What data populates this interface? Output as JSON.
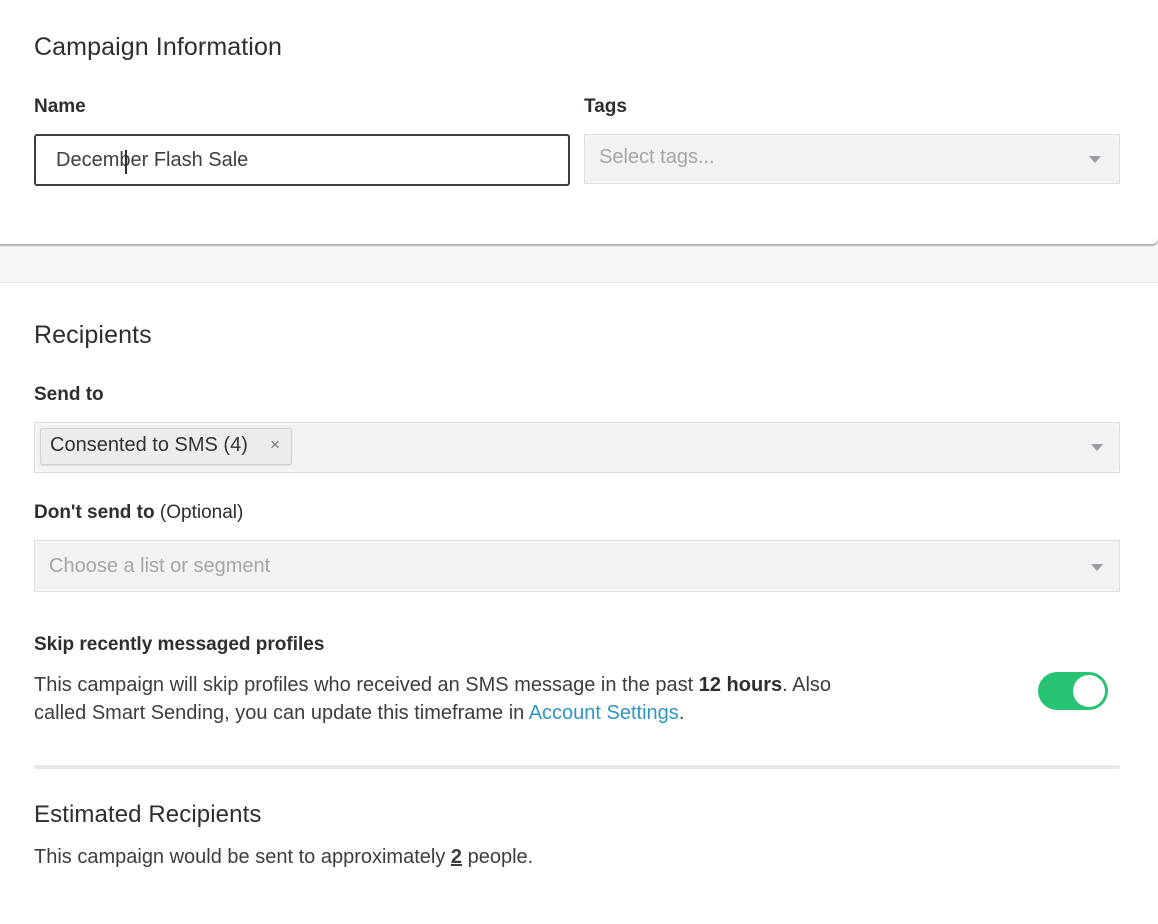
{
  "campaign_info": {
    "title": "Campaign Information",
    "name_label": "Name",
    "name_value": "December Flash Sale",
    "tags_label": "Tags",
    "tags_placeholder": "Select tags..."
  },
  "recipients": {
    "title": "Recipients",
    "send_to_label": "Send to",
    "send_to_chips": [
      {
        "label": "Consented to SMS (4)",
        "remove_glyph": "×"
      }
    ],
    "dont_send_label": "Don't send to",
    "dont_send_optional": "(Optional)",
    "dont_send_placeholder": "Choose a list or segment",
    "skip_title": "Skip recently messaged profiles",
    "skip_text_1": "This campaign will skip profiles who received an SMS message in the past ",
    "skip_text_bold": "12 hours",
    "skip_text_2": ". Also",
    "skip_text_3": "called Smart Sending, you can update this timeframe in ",
    "skip_link": "Account Settings",
    "skip_text_4": ".",
    "skip_toggle_on": true,
    "toggle_color": "#27c272",
    "link_color": "#2f95c4"
  },
  "estimated": {
    "title": "Estimated Recipients",
    "text_1": "This campaign would be sent to approximately ",
    "count": "2",
    "text_2": " people."
  },
  "icons": {
    "dropdown": "caret-down-icon",
    "chip_remove": "close-icon"
  }
}
